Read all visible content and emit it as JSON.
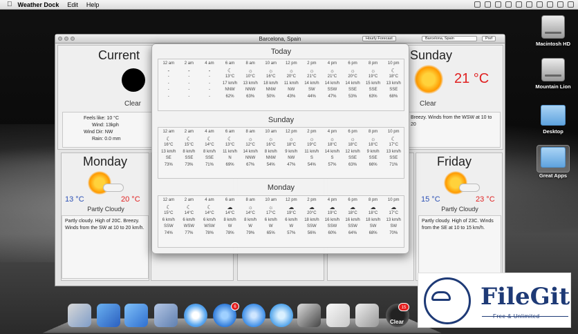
{
  "menubar": {
    "app": "Weather Dock",
    "menus": [
      "Edit",
      "Help"
    ]
  },
  "desktop": {
    "icons": [
      {
        "label": "Macintosh HD",
        "kind": "drive-icon"
      },
      {
        "label": "Mountain Lion",
        "kind": "drive-icon"
      },
      {
        "label": "Desktop",
        "kind": "folder-icon"
      },
      {
        "label": "Great Apps",
        "kind": "folder-icon"
      }
    ]
  },
  "window": {
    "title": "Barcelona, Spain",
    "forecast_button": "Hourly Forecast",
    "location_select": "Barcelona, Spain",
    "pref_button": "Pref"
  },
  "current": {
    "title": "Current",
    "condition": "Clear",
    "feels_like": "Feels like: 10 °C",
    "wind": "Wind: 13kph",
    "wind_dir": "Wind Dir: NW",
    "rain": "Rain: 0.0 mm"
  },
  "sunday_card": {
    "title": "Sunday",
    "temp": "21 °C",
    "condition": "Clear",
    "desc": "Breezy. Winds from the WSW at 10 to 20"
  },
  "monday_card": {
    "title": "Monday",
    "low": "13 °C",
    "high": "20 °C",
    "condition": "Partly Cloudy",
    "desc": "Partly cloudy. High of 20C. Breezy. Winds from the SW at 10 to 20 km/h."
  },
  "friday_card": {
    "title": "Friday",
    "low": "15 °C",
    "high": "23 °C",
    "condition": "Partly Cloudy",
    "desc": "Partly cloudy. High of 23C. Winds from the SE at 10 to 15 km/h."
  },
  "hourly": [
    {
      "title": "Today",
      "hours": [
        "12 am",
        "2 am",
        "4 am",
        "6 am",
        "8 am",
        "10 am",
        "12 pm",
        "2 pm",
        "4 pm",
        "6 pm",
        "8 pm",
        "10 pm"
      ],
      "icons": [
        "-",
        "-",
        "-",
        "☾",
        "☼",
        "☼",
        "☼",
        "☼",
        "☼",
        "☼",
        "☼",
        "☾"
      ],
      "temps": [
        "-",
        "-",
        "-",
        "13°C",
        "10°C",
        "16°C",
        "20°C",
        "21°C",
        "21°C",
        "20°C",
        "19°C",
        "18°C"
      ],
      "wind": [
        "-",
        "-",
        "-",
        "17 km/h",
        "13 km/h",
        "18 km/h",
        "11 km/h",
        "14 km/h",
        "14 km/h",
        "14 km/h",
        "15 km/h",
        "13 km/h"
      ],
      "dir": [
        "-",
        "-",
        "-",
        "NNW",
        "NNW",
        "NNW",
        "NW",
        "SW",
        "SSW",
        "SSE",
        "SSE",
        "SSE"
      ],
      "humidity": [
        "-",
        "-",
        "-",
        "62%",
        "63%",
        "50%",
        "43%",
        "44%",
        "47%",
        "53%",
        "63%",
        "68%"
      ]
    },
    {
      "title": "Sunday",
      "hours": [
        "12 am",
        "2 am",
        "4 am",
        "6 am",
        "8 am",
        "10 am",
        "12 pm",
        "2 pm",
        "4 pm",
        "6 pm",
        "8 pm",
        "10 pm"
      ],
      "icons": [
        "☾",
        "☾",
        "☾",
        "☾",
        "☼",
        "☼",
        "☼",
        "☼",
        "☼",
        "☼",
        "☼",
        "☾"
      ],
      "temps": [
        "16°C",
        "15°C",
        "14°C",
        "13°C",
        "12°C",
        "16°C",
        "18°C",
        "19°C",
        "18°C",
        "18°C",
        "18°C",
        "17°C"
      ],
      "wind": [
        "13 km/h",
        "8 km/h",
        "8 km/h",
        "11 km/h",
        "14 km/h",
        "8 km/h",
        "9 km/h",
        "11 km/h",
        "14 km/h",
        "12 km/h",
        "9 km/h",
        "13 km/h"
      ],
      "dir": [
        "SE",
        "SSE",
        "SSE",
        "N",
        "NNW",
        "NNW",
        "NW",
        "S",
        "S",
        "SSE",
        "SSE",
        "SSE"
      ],
      "humidity": [
        "73%",
        "73%",
        "71%",
        "69%",
        "67%",
        "54%",
        "47%",
        "54%",
        "57%",
        "63%",
        "66%",
        "71%"
      ]
    },
    {
      "title": "Monday",
      "hours": [
        "12 am",
        "2 am",
        "4 am",
        "6 am",
        "8 am",
        "10 am",
        "12 pm",
        "2 pm",
        "4 pm",
        "6 pm",
        "8 pm",
        "10 pm"
      ],
      "icons": [
        "☾",
        "☾",
        "☾",
        "☁",
        "☼",
        "☼",
        "☁",
        "☁",
        "☁",
        "☁",
        "☁",
        "☁"
      ],
      "temps": [
        "15°C",
        "14°C",
        "14°C",
        "14°C",
        "14°C",
        "17°C",
        "19°C",
        "20°C",
        "19°C",
        "18°C",
        "18°C",
        "17°C"
      ],
      "wind": [
        "6 km/h",
        "6 km/h",
        "6 km/h",
        "8 km/h",
        "8 km/h",
        "6 km/h",
        "6 km/h",
        "18 km/h",
        "16 km/h",
        "16 km/h",
        "18 km/h",
        "13 km/h"
      ],
      "dir": [
        "SSW",
        "WSW",
        "WSW",
        "W",
        "W",
        "W",
        "W",
        "SSW",
        "SSW",
        "SSW",
        "SW",
        "SW"
      ],
      "humidity": [
        "74%",
        "77%",
        "78%",
        "78%",
        "79%",
        "65%",
        "57%",
        "56%",
        "60%",
        "64%",
        "68%",
        "70%"
      ]
    }
  ],
  "dock": {
    "badges": [
      "6",
      "15"
    ],
    "ending_label": "Clear"
  },
  "watermark": {
    "name": "FileGit",
    "tagline": "Free & Unlimited"
  }
}
